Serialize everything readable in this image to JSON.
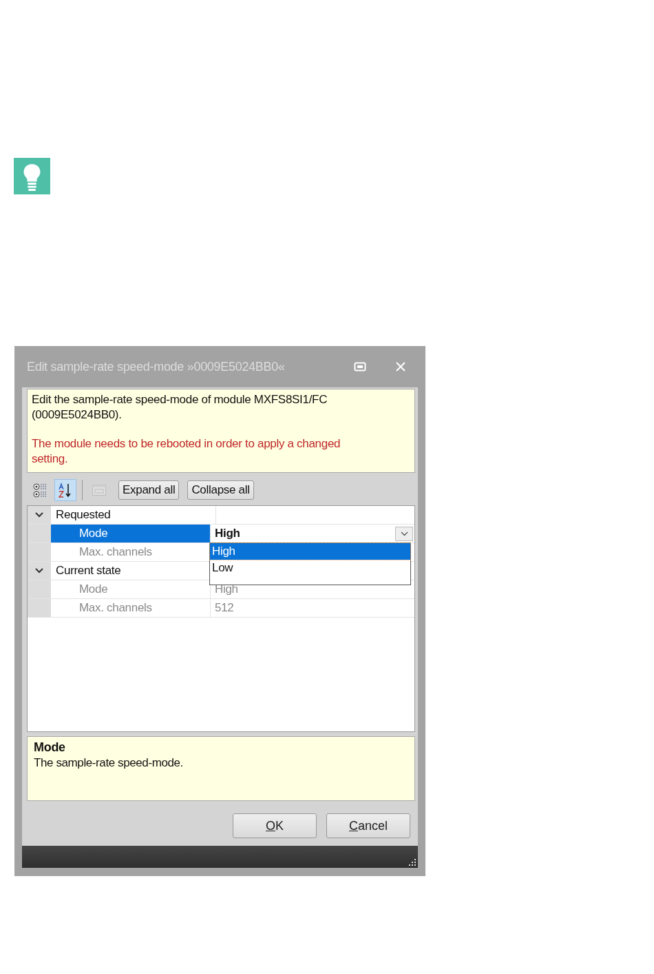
{
  "tip": {
    "kind": "lightbulb"
  },
  "window": {
    "title": "Edit sample-rate speed-mode »0009E5024BB0«"
  },
  "info": {
    "text": "Edit the sample-rate speed-mode of module MXFS8SI1/FC (0009E5024BB0).",
    "warning": "The module needs to be rebooted in order to apply a changed setting."
  },
  "toolbar": {
    "view_buttons": [
      {
        "kind": "categorized",
        "selected": false,
        "disabled": false
      },
      {
        "kind": "alphabetical",
        "selected": true,
        "disabled": false
      },
      {
        "kind": "pages",
        "selected": false,
        "disabled": true
      }
    ],
    "buttons": [
      "Expand all",
      "Collapse all"
    ]
  },
  "grid": {
    "categories": [
      {
        "label": "Requested",
        "expanded": true,
        "children": [
          {
            "name": "Mode",
            "value": "High",
            "selected": true,
            "readonly": false,
            "modified": true
          },
          {
            "name": "Max. channels",
            "selected": false,
            "readonly": true,
            "modified": false
          }
        ]
      },
      {
        "label": "Current state",
        "expanded": true,
        "children": [
          {
            "name": "Mode",
            "value": "High",
            "selected": false,
            "readonly": true,
            "modified": false
          },
          {
            "name": "Max. channels",
            "value": "512",
            "selected": false,
            "readonly": true,
            "modified": false
          }
        ]
      }
    ],
    "dropdown": {
      "options": [
        {
          "label": "High",
          "selected": true
        },
        {
          "label": "Low",
          "selected": false
        }
      ]
    }
  },
  "description": {
    "title": "Mode",
    "text": "The sample-rate speed-mode."
  },
  "buttons": [
    {
      "label": "OK"
    },
    {
      "label": "Cancel"
    }
  ]
}
